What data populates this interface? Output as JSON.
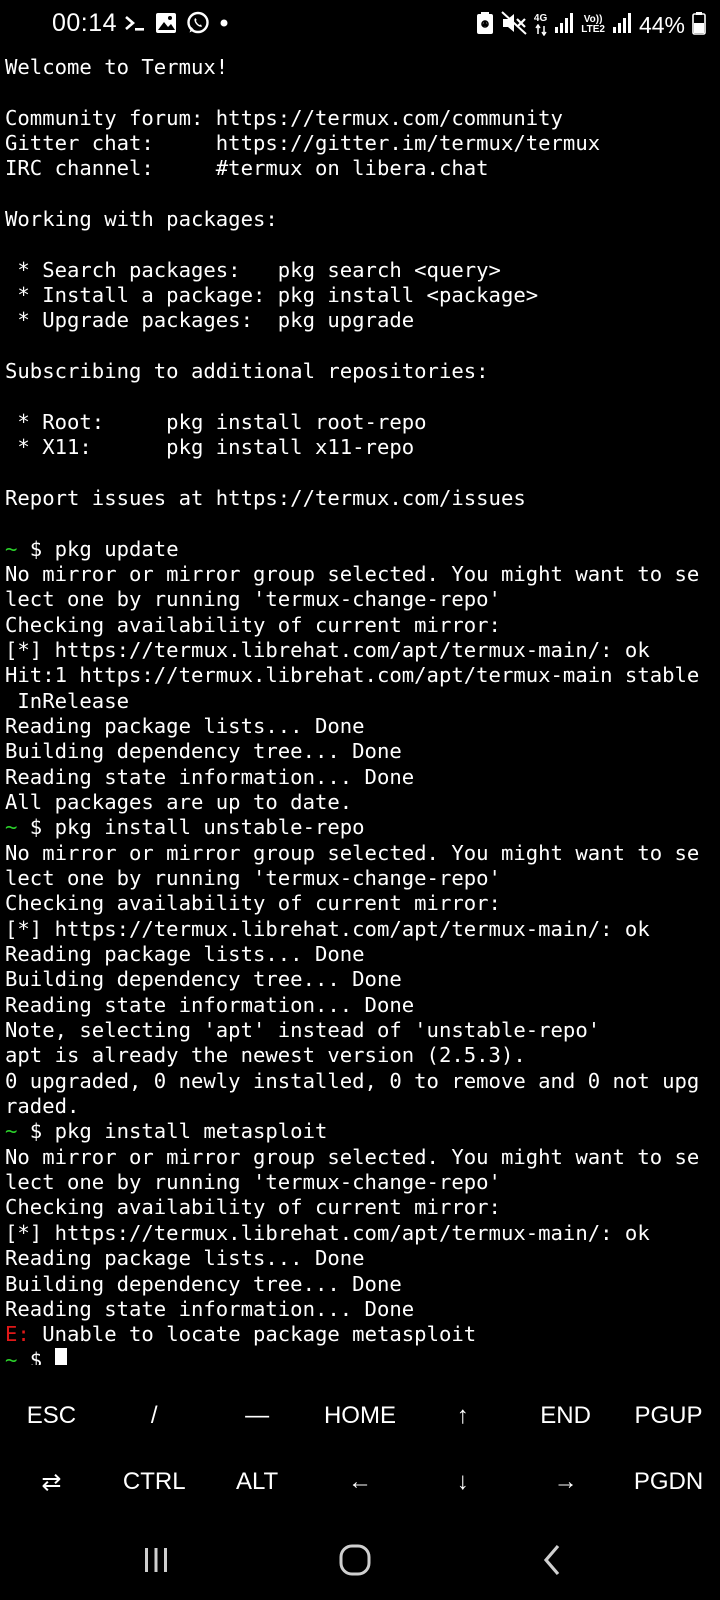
{
  "status_bar": {
    "time": "00:14",
    "left_icons": [
      "terminal-prompt-icon",
      "image-icon",
      "whatsapp-icon",
      "dot-icon"
    ],
    "network_type": "4G",
    "volte_label": "Vo))",
    "lte2_label": "LTE2",
    "battery_percent": "44%"
  },
  "terminal": {
    "lines": [
      {
        "text": "Welcome to Termux!"
      },
      {
        "text": ""
      },
      {
        "text": "Community forum: https://termux.com/community"
      },
      {
        "text": "Gitter chat:     https://gitter.im/termux/termux"
      },
      {
        "text": "IRC channel:     #termux on libera.chat"
      },
      {
        "text": ""
      },
      {
        "text": "Working with packages:"
      },
      {
        "text": ""
      },
      {
        "text": " * Search packages:   pkg search <query>"
      },
      {
        "text": " * Install a package: pkg install <package>"
      },
      {
        "text": " * Upgrade packages:  pkg upgrade"
      },
      {
        "text": ""
      },
      {
        "text": "Subscribing to additional repositories:"
      },
      {
        "text": ""
      },
      {
        "text": " * Root:     pkg install root-repo"
      },
      {
        "text": " * X11:      pkg install x11-repo"
      },
      {
        "text": ""
      },
      {
        "text": "Report issues at https://termux.com/issues"
      },
      {
        "text": ""
      },
      {
        "prompt": "~",
        "text": " $ pkg update"
      },
      {
        "text": "No mirror or mirror group selected. You might want to se"
      },
      {
        "text": "lect one by running 'termux-change-repo'"
      },
      {
        "text": "Checking availability of current mirror:"
      },
      {
        "text": "[*] https://termux.librehat.com/apt/termux-main/: ok"
      },
      {
        "text": "Hit:1 https://termux.librehat.com/apt/termux-main stable"
      },
      {
        "text": " InRelease"
      },
      {
        "text": "Reading package lists... Done"
      },
      {
        "text": "Building dependency tree... Done"
      },
      {
        "text": "Reading state information... Done"
      },
      {
        "text": "All packages are up to date."
      },
      {
        "prompt": "~",
        "text": " $ pkg install unstable-repo"
      },
      {
        "text": "No mirror or mirror group selected. You might want to se"
      },
      {
        "text": "lect one by running 'termux-change-repo'"
      },
      {
        "text": "Checking availability of current mirror:"
      },
      {
        "text": "[*] https://termux.librehat.com/apt/termux-main/: ok"
      },
      {
        "text": "Reading package lists... Done"
      },
      {
        "text": "Building dependency tree... Done"
      },
      {
        "text": "Reading state information... Done"
      },
      {
        "text": "Note, selecting 'apt' instead of 'unstable-repo'"
      },
      {
        "text": "apt is already the newest version (2.5.3)."
      },
      {
        "text": "0 upgraded, 0 newly installed, 0 to remove and 0 not upg"
      },
      {
        "text": "raded."
      },
      {
        "prompt": "~",
        "text": " $ pkg install metasploit"
      },
      {
        "text": "No mirror or mirror group selected. You might want to se"
      },
      {
        "text": "lect one by running 'termux-change-repo'"
      },
      {
        "text": "Checking availability of current mirror:"
      },
      {
        "text": "[*] https://termux.librehat.com/apt/termux-main/: ok"
      },
      {
        "text": "Reading package lists... Done"
      },
      {
        "text": "Building dependency tree... Done"
      },
      {
        "text": "Reading state information... Done"
      },
      {
        "error": "E:",
        "text": " Unable to locate package metasploit"
      },
      {
        "prompt": "~",
        "text": " $ ",
        "cursor": true
      }
    ]
  },
  "extra_keys": {
    "row1": [
      {
        "label": "ESC",
        "name": "esc-key"
      },
      {
        "label": "/",
        "name": "slash-key"
      },
      {
        "label": "—",
        "name": "dash-key"
      },
      {
        "label": "HOME",
        "name": "home-key"
      },
      {
        "label": "↑",
        "name": "up-arrow-key"
      },
      {
        "label": "END",
        "name": "end-key"
      },
      {
        "label": "PGUP",
        "name": "pgup-key"
      }
    ],
    "row2": [
      {
        "label": "⇄",
        "name": "tab-key"
      },
      {
        "label": "CTRL",
        "name": "ctrl-key"
      },
      {
        "label": "ALT",
        "name": "alt-key"
      },
      {
        "label": "←",
        "name": "left-arrow-key"
      },
      {
        "label": "↓",
        "name": "down-arrow-key"
      },
      {
        "label": "→",
        "name": "right-arrow-key"
      },
      {
        "label": "PGDN",
        "name": "pgdn-key"
      }
    ]
  },
  "nav_bar": {
    "buttons": [
      "recents-icon",
      "home-icon",
      "back-icon"
    ]
  },
  "colors": {
    "background": "#000000",
    "text": "#ffffff",
    "prompt_tilde": "#2bd02b",
    "error": "#e01818"
  }
}
